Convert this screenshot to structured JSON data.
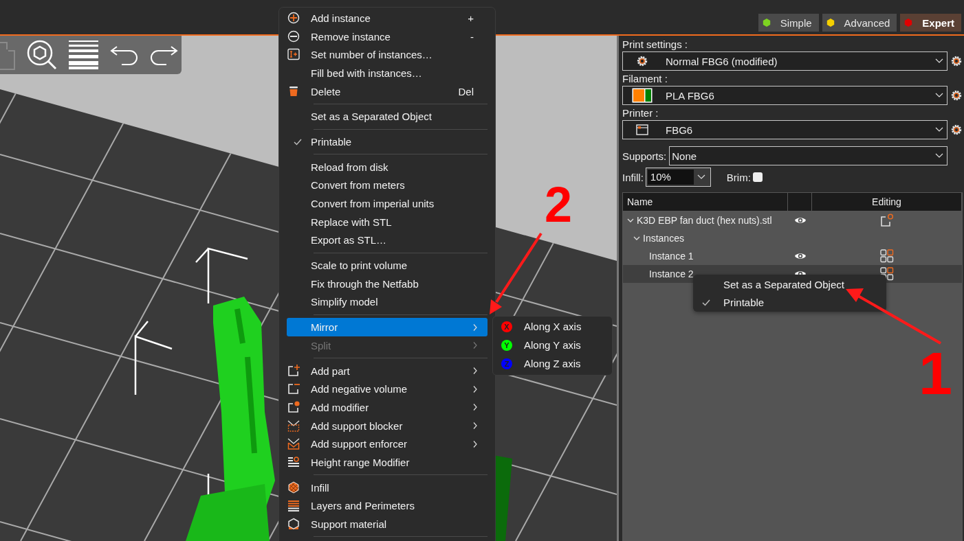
{
  "mode_tabs": [
    {
      "label": "Simple",
      "color": "#7ed321",
      "selected": false
    },
    {
      "label": "Advanced",
      "color": "#f5d000",
      "selected": false
    },
    {
      "label": "Expert",
      "color": "#e00000",
      "selected": true
    }
  ],
  "presets": [
    {
      "kind": "print",
      "label": "Print settings :",
      "value": "Normal FBG6 (modified)"
    },
    {
      "kind": "filament",
      "label": "Filament :",
      "value": "PLA FBG6"
    },
    {
      "kind": "printer",
      "label": "Printer :",
      "value": "FBG6"
    }
  ],
  "supports": {
    "label": "Supports:",
    "value": "None"
  },
  "infill": {
    "label": "Infill:",
    "value": "10%"
  },
  "brim": {
    "label": "Brim:",
    "checked": false
  },
  "object_list": {
    "columns": [
      "Name",
      "Editing"
    ],
    "rows": [
      {
        "kind": "object",
        "label": "K3D EBP fan duct (hex nuts).stl",
        "expanded": true,
        "selected": false,
        "children": [
          {
            "kind": "instances",
            "label": "Instances",
            "expanded": true,
            "selected": false,
            "children": [
              {
                "kind": "instance",
                "label": "Instance 1",
                "selected": false
              },
              {
                "kind": "instance",
                "label": "Instance 2",
                "selected": true
              }
            ]
          }
        ]
      }
    ]
  },
  "context_menu": {
    "items": [
      {
        "kind": "item",
        "label": "Add instance",
        "shortcut": "+",
        "checked": false,
        "disabled": false,
        "selected": false,
        "submenu": false
      },
      {
        "kind": "item",
        "label": "Remove instance",
        "shortcut": "-",
        "checked": false,
        "disabled": false,
        "selected": false,
        "submenu": false
      },
      {
        "kind": "item",
        "label": "Set number of instances…",
        "checked": false,
        "disabled": false,
        "selected": false,
        "submenu": false
      },
      {
        "kind": "item",
        "label": "Fill bed with instances…",
        "checked": false,
        "disabled": false,
        "selected": false,
        "submenu": false
      },
      {
        "kind": "item",
        "label": "Delete",
        "shortcut": "Del",
        "checked": false,
        "disabled": false,
        "selected": false,
        "submenu": false
      },
      {
        "kind": "separator"
      },
      {
        "kind": "item",
        "label": "Set as a Separated Object",
        "checked": false,
        "disabled": false,
        "selected": false,
        "submenu": false
      },
      {
        "kind": "separator"
      },
      {
        "kind": "item",
        "label": "Printable",
        "checked": true,
        "disabled": false,
        "selected": false,
        "submenu": false
      },
      {
        "kind": "separator"
      },
      {
        "kind": "item",
        "label": "Reload from disk",
        "checked": false,
        "disabled": false,
        "selected": false,
        "submenu": false
      },
      {
        "kind": "item",
        "label": "Convert from meters",
        "checked": false,
        "disabled": false,
        "selected": false,
        "submenu": false
      },
      {
        "kind": "item",
        "label": "Convert from imperial units",
        "checked": false,
        "disabled": false,
        "selected": false,
        "submenu": false
      },
      {
        "kind": "item",
        "label": "Replace with STL",
        "checked": false,
        "disabled": false,
        "selected": false,
        "submenu": false
      },
      {
        "kind": "item",
        "label": "Export as STL…",
        "checked": false,
        "disabled": false,
        "selected": false,
        "submenu": false
      },
      {
        "kind": "separator"
      },
      {
        "kind": "item",
        "label": "Scale to print volume",
        "checked": false,
        "disabled": false,
        "selected": false,
        "submenu": false
      },
      {
        "kind": "item",
        "label": "Fix through the Netfabb",
        "checked": false,
        "disabled": false,
        "selected": false,
        "submenu": false
      },
      {
        "kind": "item",
        "label": "Simplify model",
        "checked": false,
        "disabled": false,
        "selected": false,
        "submenu": false
      },
      {
        "kind": "separator"
      },
      {
        "kind": "item",
        "label": "Mirror",
        "checked": false,
        "disabled": false,
        "selected": true,
        "submenu": true
      },
      {
        "kind": "item",
        "label": "Split",
        "checked": false,
        "disabled": true,
        "selected": false,
        "submenu": true
      },
      {
        "kind": "separator"
      },
      {
        "kind": "item",
        "label": "Add part",
        "checked": false,
        "disabled": false,
        "selected": false,
        "submenu": true
      },
      {
        "kind": "item",
        "label": "Add negative volume",
        "checked": false,
        "disabled": false,
        "selected": false,
        "submenu": true
      },
      {
        "kind": "item",
        "label": "Add modifier",
        "checked": false,
        "disabled": false,
        "selected": false,
        "submenu": true
      },
      {
        "kind": "item",
        "label": "Add support blocker",
        "checked": false,
        "disabled": false,
        "selected": false,
        "submenu": true
      },
      {
        "kind": "item",
        "label": "Add support enforcer",
        "checked": false,
        "disabled": false,
        "selected": false,
        "submenu": true
      },
      {
        "kind": "item",
        "label": "Height range Modifier",
        "checked": false,
        "disabled": false,
        "selected": false,
        "submenu": false
      },
      {
        "kind": "separator"
      },
      {
        "kind": "item",
        "label": "Infill",
        "checked": false,
        "disabled": false,
        "selected": false,
        "submenu": false
      },
      {
        "kind": "item",
        "label": "Layers and Perimeters",
        "checked": false,
        "disabled": false,
        "selected": false,
        "submenu": false
      },
      {
        "kind": "item",
        "label": "Support material",
        "checked": false,
        "disabled": false,
        "selected": false,
        "submenu": false
      },
      {
        "kind": "separator"
      }
    ]
  },
  "mirror_submenu": {
    "items": [
      {
        "letter": "X",
        "label": "Along X axis",
        "color": "#ff0000"
      },
      {
        "letter": "Y",
        "label": "Along Y axis",
        "color": "#00ff00"
      },
      {
        "letter": "Z",
        "label": "Along Z axis",
        "color": "#0000ff"
      }
    ]
  },
  "instance_popup": {
    "items": [
      {
        "label": "Set as a Separated Object",
        "checked": false
      },
      {
        "label": "Printable",
        "checked": true
      }
    ]
  },
  "annotations": [
    {
      "label": "2"
    },
    {
      "label": "1"
    }
  ]
}
